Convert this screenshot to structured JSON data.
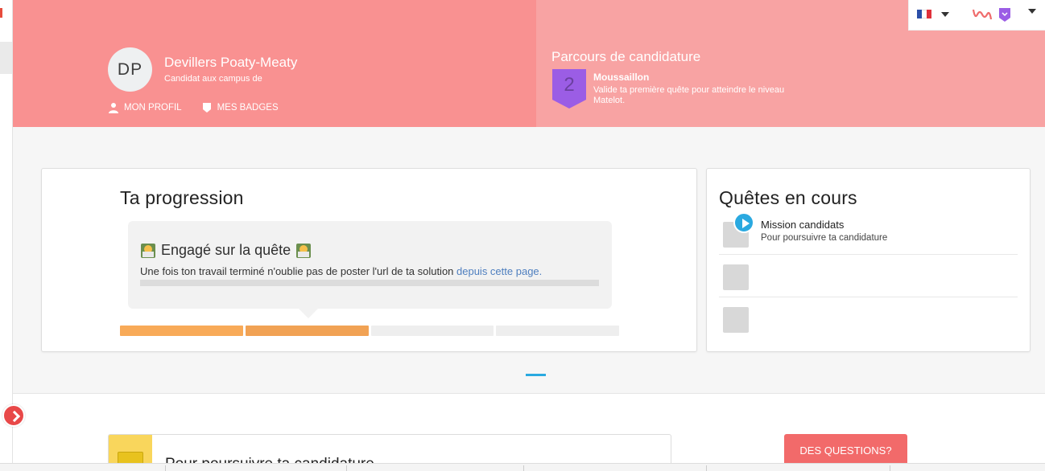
{
  "user": {
    "initials": "DP",
    "name": "Devillers Poaty-Meaty",
    "subtitle": "Candidat aux campus de",
    "links": {
      "profile": "Mon profil",
      "badges": "Mes badges"
    }
  },
  "parcours": {
    "title": "Parcours de candidature",
    "level_number": "2",
    "level_name": "Moussaillon",
    "level_desc": "Valide ta première quête pour atteindre le niveau Matelot."
  },
  "topbar": {
    "language_icon": "french-flag-icon",
    "logo_icon": "logo-icon"
  },
  "progression": {
    "title": "Ta progression",
    "bubble_title": "Engagé sur la quête",
    "bubble_text": "Une fois ton travail terminé n'oublie pas de poster l'url de ta solution ",
    "bubble_link": "depuis cette page.",
    "segments": [
      {
        "state": "done",
        "color": "#f8aa58"
      },
      {
        "state": "current",
        "color": "#f1a254"
      },
      {
        "state": "todo",
        "color": "#eeeeee"
      },
      {
        "state": "todo",
        "color": "#eeeeee"
      }
    ]
  },
  "quests": {
    "title": "Quêtes en cours",
    "items": [
      {
        "name": "Mission candidats",
        "subtitle": "Pour poursuivre ta candidature"
      },
      {
        "name": "",
        "subtitle": ""
      },
      {
        "name": "",
        "subtitle": ""
      }
    ]
  },
  "lower": {
    "next_title": "Pour poursuivre ta candidature",
    "questions_button": "Des questions?"
  },
  "colors": {
    "header_left": "#f99191",
    "header_right": "#f8a3a3",
    "accent_blue": "#2aa9e0",
    "badge_purple": "#9b5de5",
    "cta_red": "#f26a6a"
  }
}
